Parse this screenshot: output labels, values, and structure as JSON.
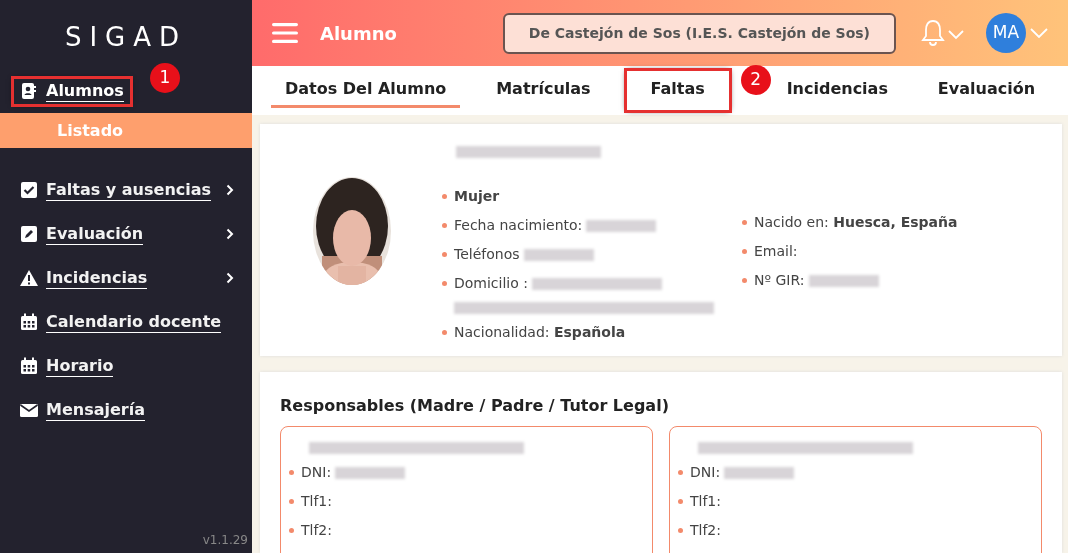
{
  "sidebar": {
    "logo": "SIGAD",
    "items": [
      {
        "label": "Alumnos",
        "kind": "contact",
        "has_submenu": false,
        "selected": true,
        "annotation": "1",
        "children": [
          {
            "label": "Listado",
            "selected": true
          }
        ]
      },
      {
        "label": "Faltas y ausencias",
        "kind": "check",
        "has_submenu": true,
        "selected": false
      },
      {
        "label": "Evaluación",
        "kind": "pencil",
        "has_submenu": true,
        "selected": false
      },
      {
        "label": "Incidencias",
        "kind": "warning",
        "has_submenu": true,
        "selected": false
      },
      {
        "label": "Calendario docente",
        "kind": "calendar",
        "has_submenu": false,
        "selected": false
      },
      {
        "label": "Horario",
        "kind": "calendar",
        "has_submenu": false,
        "selected": false
      },
      {
        "label": "Mensajería",
        "kind": "mail",
        "has_submenu": false,
        "selected": false
      }
    ],
    "version": "v1.1.29"
  },
  "header": {
    "title": "Alumno",
    "school": "De Castejón de Sos (I.E.S. Castejón de Sos)",
    "avatar": "MA"
  },
  "tabs": [
    {
      "label": "Datos Del Alumno",
      "selected": true
    },
    {
      "label": "Matrículas",
      "selected": false
    },
    {
      "label": "Faltas",
      "selected": false,
      "annotation": "2"
    },
    {
      "label": "Incidencias",
      "selected": false
    },
    {
      "label": "Evaluación",
      "selected": false
    }
  ],
  "student": {
    "left": [
      {
        "kind": "plain",
        "value": "Mujer"
      },
      {
        "kind": "redacted",
        "label": "Fecha nacimiento:"
      },
      {
        "kind": "redacted",
        "label": "Teléfonos"
      },
      {
        "kind": "redacted-address",
        "label": "Domicilio :"
      },
      {
        "kind": "plain",
        "label": "Nacionalidad:",
        "value": "Española"
      }
    ],
    "right": [
      {
        "kind": "plain",
        "label": "Nacido en:",
        "value": "Huesca, España"
      },
      {
        "kind": "plain",
        "label": "Email:"
      },
      {
        "kind": "redacted",
        "label": "Nº GIR:"
      }
    ]
  },
  "guardians": {
    "title": "Responsables (Madre / Padre / Tutor Legal)",
    "cards": [
      {
        "fields": [
          {
            "kind": "redacted",
            "label": "DNI:"
          },
          {
            "kind": "plain",
            "label": "Tlf1:"
          },
          {
            "kind": "plain",
            "label": "Tlf2:"
          }
        ]
      },
      {
        "fields": [
          {
            "kind": "redacted",
            "label": "DNI:"
          },
          {
            "kind": "plain",
            "label": "Tlf1:"
          },
          {
            "kind": "plain",
            "label": "Tlf2:"
          }
        ]
      }
    ]
  }
}
